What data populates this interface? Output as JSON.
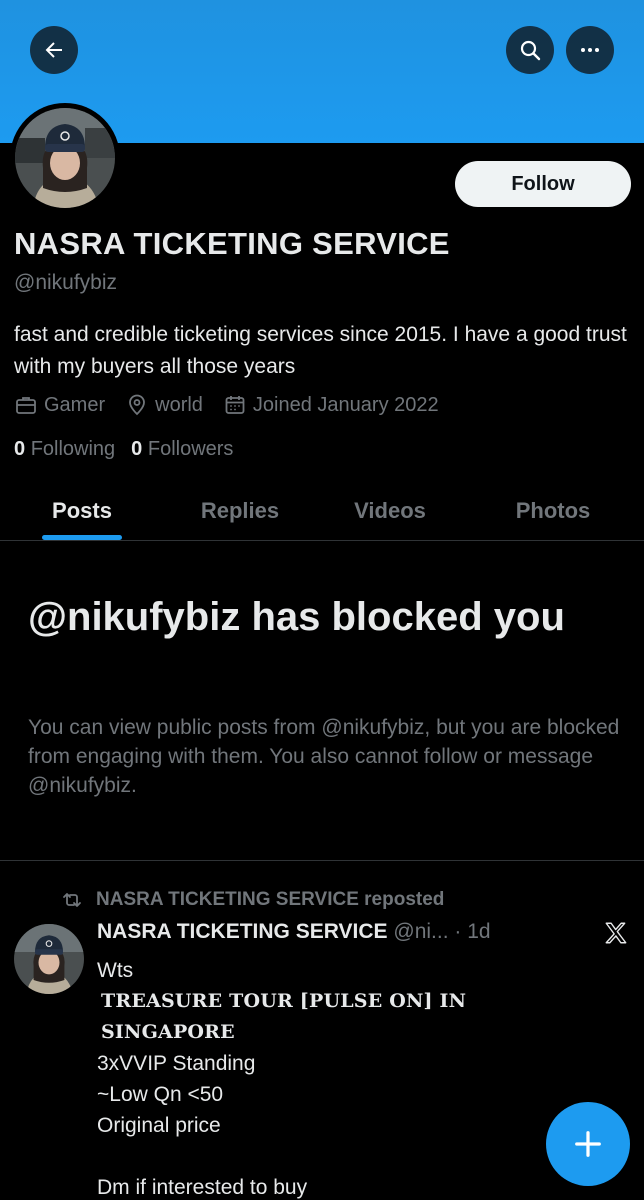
{
  "profile": {
    "display_name": "NASRA TICKETING SERVICE",
    "handle": "@nikufybiz",
    "bio": "fast and credible ticketing services since 2015. I have a good trust with my buyers all those years",
    "category": "Gamer",
    "location": "world",
    "joined": "Joined January 2022",
    "following_count": "0",
    "following_label": "Following",
    "followers_count": "0",
    "followers_label": "Followers",
    "follow_label": "Follow"
  },
  "tabs": [
    {
      "label": "Posts",
      "active": true
    },
    {
      "label": "Replies",
      "active": false
    },
    {
      "label": "Videos",
      "active": false
    },
    {
      "label": "Photos",
      "active": false
    }
  ],
  "blocked": {
    "title": "@nikufybiz has blocked you",
    "message": "You can view public posts from @nikufybiz, but you are blocked from engaging with them. You also cannot follow or message @nikufybiz."
  },
  "post": {
    "repost_label": "NASRA TICKETING SERVICE reposted",
    "author_name": "NASRA TICKETING SERVICE",
    "author_handle": "@ni...",
    "time": "· 1d",
    "lines": [
      "Wts",
      "TREASURE TOUR [PULSE ON] IN SINGAPORE",
      "3xVVIP Standing",
      "~Low Qn <50",
      "Original price",
      "",
      "Dm if interested to buy"
    ]
  },
  "colors": {
    "accent": "#1d9bf0",
    "banner": "#1d9bf0",
    "background": "#000000",
    "text_primary": "#e7e9ea",
    "text_secondary": "#71767b"
  },
  "icons": {
    "back": "arrow-left-icon",
    "search": "search-icon",
    "more": "more-icon",
    "category": "briefcase-icon",
    "location": "location-pin-icon",
    "joined": "calendar-icon",
    "repost": "repost-icon",
    "x_logo": "x-logo-icon",
    "compose": "plus-icon"
  }
}
